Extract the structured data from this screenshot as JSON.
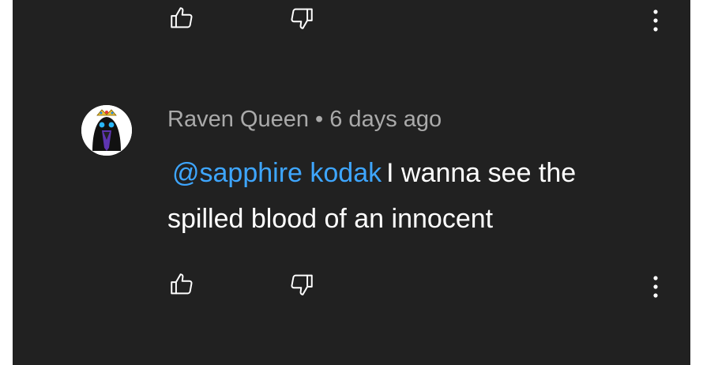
{
  "comment": {
    "author": "Raven Queen",
    "separator": "•",
    "time": "6 days ago",
    "mention": "@sapphire kodak",
    "text": "I wanna see the spilled blood of an innocent"
  },
  "icons": {
    "like": "thumbs-up-icon",
    "dislike": "thumbs-down-icon",
    "more": "more-vertical-icon"
  },
  "colors": {
    "background": "#212121",
    "secondary_text": "#aaaaaa",
    "primary_text": "#ffffff",
    "mention": "#3ea6ff"
  }
}
